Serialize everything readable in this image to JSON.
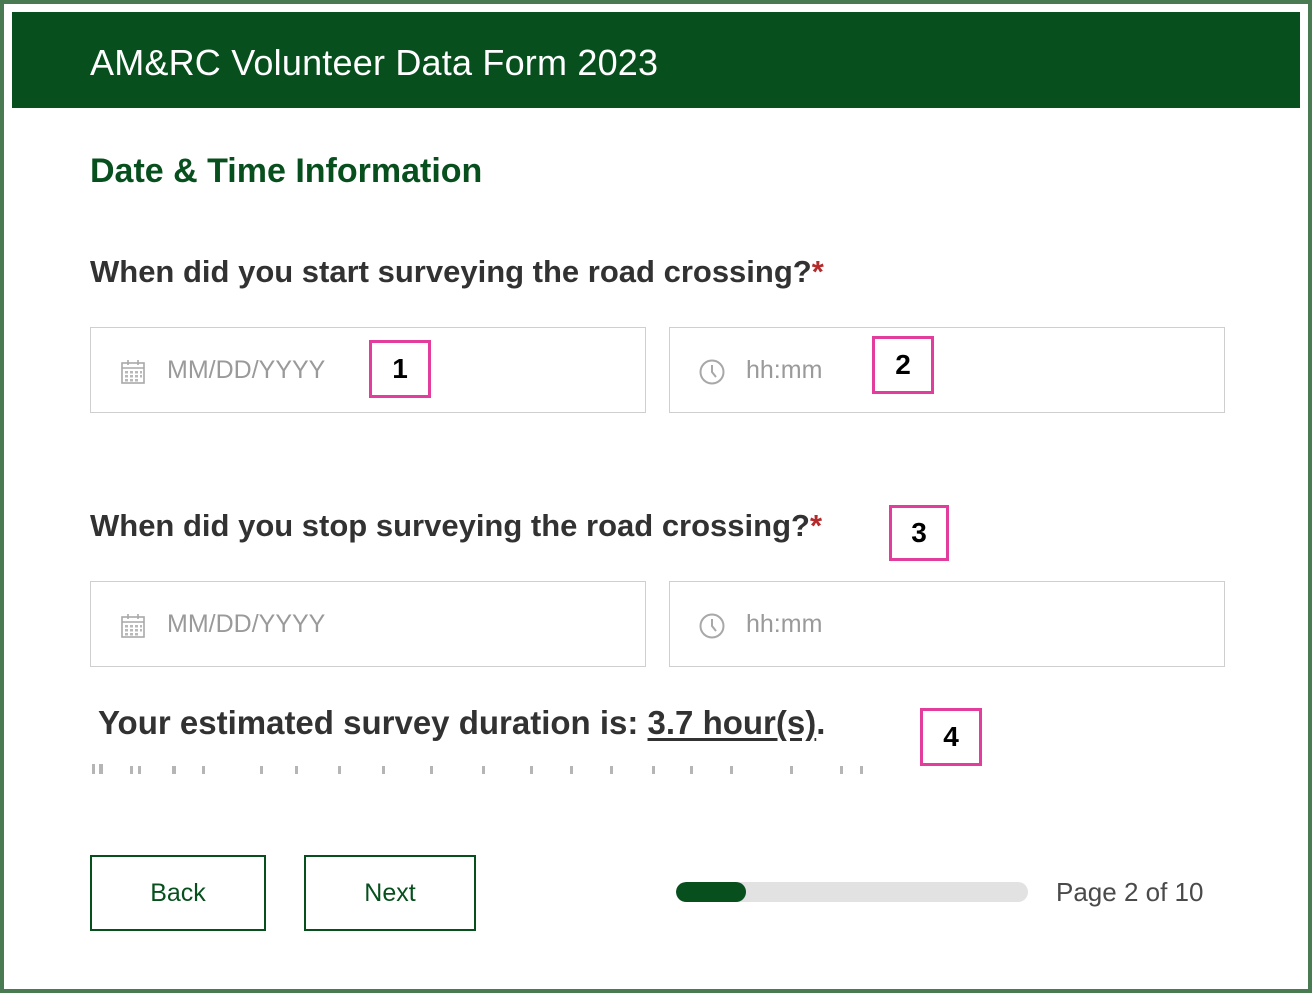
{
  "header": {
    "title": "AM&RC Volunteer Data Form 2023"
  },
  "section": {
    "title": "Date & Time Information"
  },
  "questions": [
    {
      "label": "When did you start surveying the road crossing?",
      "required_mark": "*",
      "date": {
        "placeholder": "MM/DD/YYYY",
        "value": "",
        "icon": "calendar-icon"
      },
      "time": {
        "placeholder": "hh:mm",
        "value": "",
        "icon": "clock-icon"
      }
    },
    {
      "label": "When did you stop surveying the road crossing?",
      "required_mark": "*",
      "date": {
        "placeholder": "MM/DD/YYYY",
        "value": "",
        "icon": "calendar-icon"
      },
      "time": {
        "placeholder": "hh:mm",
        "value": "",
        "icon": "clock-icon"
      }
    }
  ],
  "duration": {
    "prefix": "Your estimated survey duration is: ",
    "value": "3.7 hour(s)",
    "suffix": "."
  },
  "markers": [
    "1",
    "2",
    "3",
    "4"
  ],
  "nav": {
    "back_label": "Back",
    "next_label": "Next"
  },
  "progress": {
    "fraction": 0.2,
    "page_text": "Page 2 of 10"
  },
  "colors": {
    "brand": "#07501e",
    "required": "#b52b2b",
    "marker_border": "#e23c9c"
  }
}
